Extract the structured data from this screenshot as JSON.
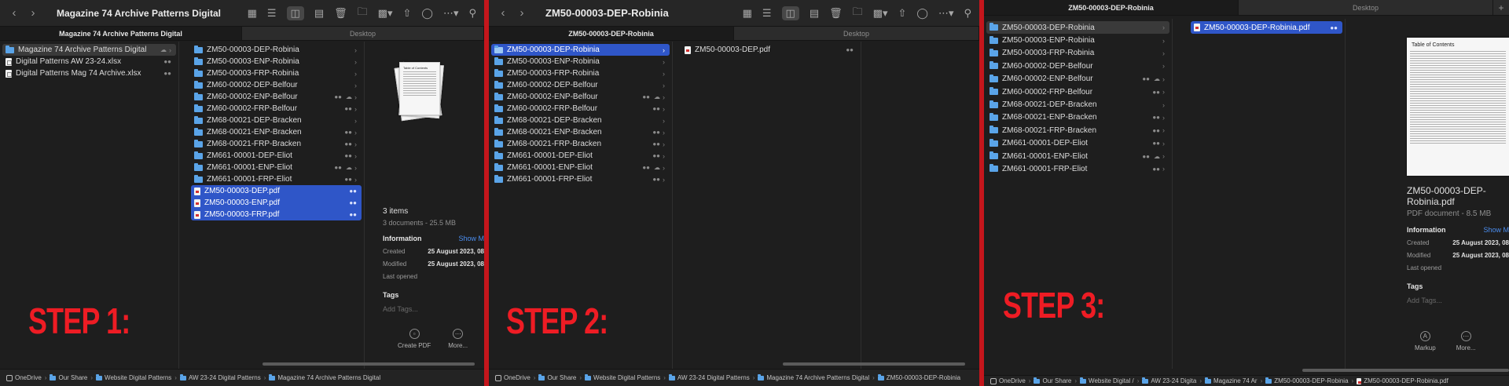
{
  "colors": {
    "accent_selection": "#2f56c8",
    "step_label": "#ee1c24",
    "background": "#1e1e1e",
    "divider": "#c4161c"
  },
  "icons": {
    "back": "chevron-left-icon",
    "forward": "chevron-right-icon",
    "search": "search-icon",
    "share_badge": "people-icon",
    "cloud_badge": "cloud-icon"
  },
  "step1": {
    "label": "STEP 1:",
    "window_title": "Magazine 74 Archive Patterns Digital",
    "tabs": [
      "Magazine 74 Archive Patterns Digital",
      "Desktop"
    ],
    "sidebar": [
      {
        "name": "Magazine 74 Archive Patterns Digital",
        "type": "folder"
      },
      {
        "name": "Digital Patterns AW 23-24.xlsx",
        "type": "xlsx"
      },
      {
        "name": "Digital Patterns Mag 74 Archive.xlsx",
        "type": "xlsx"
      }
    ],
    "folders": [
      "ZM50-00003-DEP-Robinia",
      "ZM50-00003-ENP-Robinia",
      "ZM50-00003-FRP-Robinia",
      "ZM60-00002-DEP-Belfour",
      "ZM60-00002-ENP-Belfour",
      "ZM60-00002-FRP-Belfour",
      "ZM68-00021-DEP-Bracken",
      "ZM68-00021-ENP-Bracken",
      "ZM68-00021-FRP-Bracken",
      "ZM661-00001-DEP-Eliot",
      "ZM661-00001-ENP-Eliot",
      "ZM661-00001-FRP-Eliot"
    ],
    "files": [
      "ZM50-00003-DEP.pdf",
      "ZM50-00003-ENP.pdf",
      "ZM50-00003-FRP.pdf"
    ],
    "preview": {
      "toc_title": "Table of Contents",
      "count": "3 items",
      "summary": "3 documents - 25.5 MB",
      "info_heading": "Information",
      "show_more": "Show M",
      "created_label": "Created",
      "created_value": "25 August 2023, 08",
      "modified_label": "Modified",
      "modified_value": "25 August 2023, 08",
      "last_opened_label": "Last opened",
      "tags_heading": "Tags",
      "tags_placeholder": "Add Tags...",
      "btn_create": "Create PDF",
      "btn_more": "More..."
    },
    "path": [
      "OneDrive",
      "Our Share",
      "Website Digital Patterns",
      "AW 23-24 Digital Patterns",
      "Magazine 74 Archive Patterns Digital"
    ]
  },
  "step2": {
    "label": "STEP 2:",
    "window_title": "ZM50-00003-DEP-Robinia",
    "tabs": [
      "ZM50-00003-DEP-Robinia",
      "Desktop"
    ],
    "folders": [
      "ZM50-00003-DEP-Robinia",
      "ZM50-00003-ENP-Robinia",
      "ZM50-00003-FRP-Robinia",
      "ZM60-00002-DEP-Belfour",
      "ZM60-00002-ENP-Belfour",
      "ZM60-00002-FRP-Belfour",
      "ZM68-00021-DEP-Bracken",
      "ZM68-00021-ENP-Bracken",
      "ZM68-00021-FRP-Bracken",
      "ZM661-00001-DEP-Eliot",
      "ZM661-00001-ENP-Eliot",
      "ZM661-00001-FRP-Eliot"
    ],
    "file": "ZM50-00003-DEP.pdf",
    "path": [
      "OneDrive",
      "Our Share",
      "Website Digital Patterns",
      "AW 23-24 Digital Patterns",
      "Magazine 74 Archive Patterns Digital",
      "ZM50-00003-DEP-Robinia"
    ]
  },
  "step3": {
    "label": "STEP 3:",
    "tabs": [
      "ZM50-00003-DEP-Robinia",
      "Desktop"
    ],
    "folders": [
      "ZM50-00003-DEP-Robinia",
      "ZM50-00003-ENP-Robinia",
      "ZM50-00003-FRP-Robinia",
      "ZM60-00002-DEP-Belfour",
      "ZM60-00002-ENP-Belfour",
      "ZM60-00002-FRP-Belfour",
      "ZM68-00021-DEP-Bracken",
      "ZM68-00021-ENP-Bracken",
      "ZM68-00021-FRP-Bracken",
      "ZM661-00001-DEP-Eliot",
      "ZM661-00001-ENP-Eliot",
      "ZM661-00001-FRP-Eliot"
    ],
    "file": "ZM50-00003-DEP-Robinia.pdf",
    "preview": {
      "toc_title": "Table of Contents",
      "name_line1": "ZM50-00003-DEP-",
      "name_line2": "Robinia.pdf",
      "kind": "PDF document - 8.5 MB",
      "info_heading": "Information",
      "show_more": "Show M",
      "created_label": "Created",
      "created_value": "25 August 2023, 08",
      "modified_label": "Modified",
      "modified_value": "25 August 2023, 08",
      "last_opened_label": "Last opened",
      "tags_heading": "Tags",
      "tags_placeholder": "Add Tags...",
      "btn_markup": "Markup",
      "btn_more": "More..."
    },
    "path": [
      "OneDrive",
      "Our Share",
      "Website Digital /",
      "AW 23-24 Digita",
      "Magazine 74 Ar",
      "ZM50-00003-DEP-Robinia",
      "ZM50-00003-DEP-Robinia.pdf"
    ]
  }
}
